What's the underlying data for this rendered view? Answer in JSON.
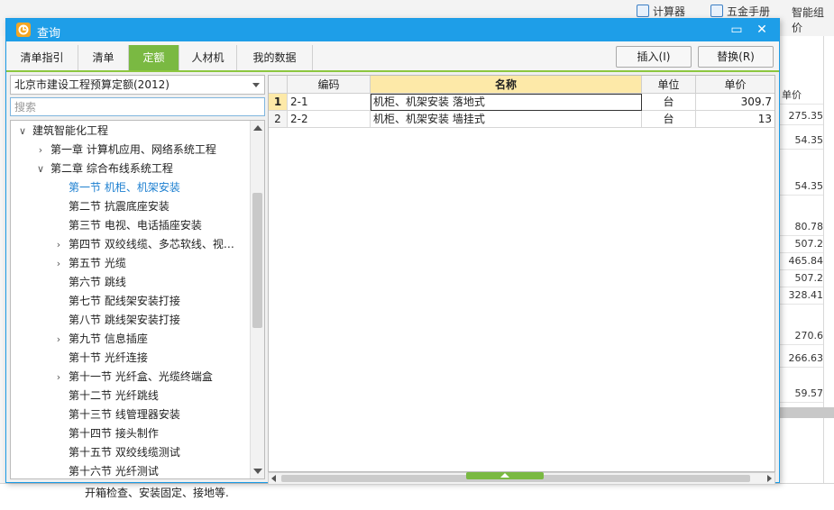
{
  "app_toolbar": {
    "calculator_label": "计算器",
    "hardware_manual_label": "五金手册",
    "smart_price_label": "智能组价"
  },
  "background_grid": {
    "header": "单价",
    "values": [
      "275.35",
      "54.35",
      "54.35",
      "80.78",
      "507.2",
      "465.84",
      "507.2",
      "328.41",
      "270.6",
      "266.63",
      "59.57"
    ]
  },
  "bottom_text": "开箱检查、安装固定、接地等.",
  "dialog": {
    "title": "查询",
    "minimize_icon": "▭",
    "close_icon": "✕",
    "tabs": [
      {
        "label": "清单指引",
        "active": false
      },
      {
        "label": "清单",
        "active": false
      },
      {
        "label": "定额",
        "active": true
      },
      {
        "label": "人材机",
        "active": false
      },
      {
        "label": "我的数据",
        "active": false
      }
    ],
    "insert_button": "插入(I)",
    "replace_button": "替换(R)",
    "quota_selector": "北京市建设工程预算定额(2012)",
    "search_placeholder": "搜索",
    "tree": [
      {
        "label": "建筑智能化工程",
        "level": 0,
        "state": "expanded"
      },
      {
        "label": "第一章 计算机应用、网络系统工程",
        "level": 1,
        "state": "collapsed"
      },
      {
        "label": "第二章 综合布线系统工程",
        "level": 1,
        "state": "expanded"
      },
      {
        "label": "第一节 机柜、机架安装",
        "level": 2,
        "state": "leaf",
        "selected": true
      },
      {
        "label": "第二节 抗震底座安装",
        "level": 2,
        "state": "leaf"
      },
      {
        "label": "第三节 电视、电话插座安装",
        "level": 2,
        "state": "leaf"
      },
      {
        "label": "第四节 双绞线缆、多芯软线、视…",
        "level": 2,
        "state": "collapsed"
      },
      {
        "label": "第五节 光缆",
        "level": 2,
        "state": "collapsed"
      },
      {
        "label": "第六节 跳线",
        "level": 2,
        "state": "leaf"
      },
      {
        "label": "第七节 配线架安装打接",
        "level": 2,
        "state": "leaf"
      },
      {
        "label": "第八节 跳线架安装打接",
        "level": 2,
        "state": "leaf"
      },
      {
        "label": "第九节 信息插座",
        "level": 2,
        "state": "collapsed"
      },
      {
        "label": "第十节 光纤连接",
        "level": 2,
        "state": "leaf"
      },
      {
        "label": "第十一节 光纤盒、光缆终端盒",
        "level": 2,
        "state": "collapsed"
      },
      {
        "label": "第十二节 光纤跳线",
        "level": 2,
        "state": "leaf"
      },
      {
        "label": "第十三节 线管理器安装",
        "level": 2,
        "state": "leaf"
      },
      {
        "label": "第十四节 接头制作",
        "level": 2,
        "state": "leaf"
      },
      {
        "label": "第十五节 双绞线缆测试",
        "level": 2,
        "state": "leaf"
      },
      {
        "label": "第十六节 光纤测试",
        "level": 2,
        "state": "leaf"
      }
    ],
    "grid": {
      "columns": [
        "",
        "编码",
        "名称",
        "单位",
        "单价"
      ],
      "rows": [
        {
          "num": "1",
          "code": "2-1",
          "name": "机柜、机架安装 落地式",
          "unit": "台",
          "price": "309.7"
        },
        {
          "num": "2",
          "code": "2-2",
          "name": "机柜、机架安装 墙挂式",
          "unit": "台",
          "price": "13"
        }
      ]
    }
  }
}
